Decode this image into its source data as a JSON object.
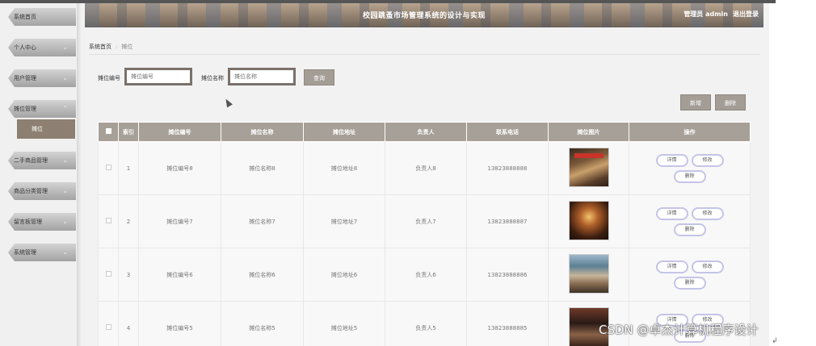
{
  "header": {
    "title": "校园跳蚤市场管理系统的设计与实现",
    "user": "管理员 admin",
    "logout": "退出登录"
  },
  "sidebar": {
    "items": [
      {
        "label": "系统首页"
      },
      {
        "label": "个人中心"
      },
      {
        "label": "用户管理"
      },
      {
        "label": "摊位管理"
      },
      {
        "label": "二手商品管理"
      },
      {
        "label": "商品分类管理"
      },
      {
        "label": "留言板管理"
      },
      {
        "label": "系统管理"
      }
    ],
    "active_sub": "摊位"
  },
  "breadcrumb": {
    "home": "系统首页",
    "separator": ":",
    "current": "摊位"
  },
  "search": {
    "code_label": "摊位编号",
    "code_placeholder": "摊位编号",
    "name_label": "摊位名称",
    "name_placeholder": "摊位名称",
    "query_button": "查询"
  },
  "toolbar": {
    "add_button": "新增",
    "delete_button": "删除"
  },
  "table": {
    "columns": [
      "索引",
      "摊位编号",
      "摊位名称",
      "摊位地址",
      "负责人",
      "联系电话",
      "摊位图片",
      "操作"
    ],
    "rows": [
      {
        "index": "1",
        "code": "摊位编号8",
        "name": "摊位名称8",
        "address": "摊位地址8",
        "owner": "负责人8",
        "phone": "13823888888"
      },
      {
        "index": "2",
        "code": "摊位编号7",
        "name": "摊位名称7",
        "address": "摊位地址7",
        "owner": "负责人7",
        "phone": "13823888887"
      },
      {
        "index": "3",
        "code": "摊位编号6",
        "name": "摊位名称6",
        "address": "摊位地址6",
        "owner": "负责人6",
        "phone": "13823888886"
      },
      {
        "index": "4",
        "code": "摊位编号5",
        "name": "摊位名称5",
        "address": "摊位地址5",
        "owner": "负责人5",
        "phone": "13823888885"
      }
    ],
    "actions": {
      "detail": "详情",
      "edit": "修改",
      "delete": "删除"
    }
  },
  "watermark": "CSDN @卓杰计算机程序设计",
  "colors": {
    "header_bg": "#8e7d6c",
    "table_header_bg": "#a6a098",
    "button_bg": "#a49d96",
    "sidebar_active_bg": "#8d8072",
    "action_border": "#c4c4e8"
  },
  "icons": [
    "chevron-down-icon",
    "chevron-up-icon",
    "checkbox-icon",
    "cursor-icon"
  ]
}
